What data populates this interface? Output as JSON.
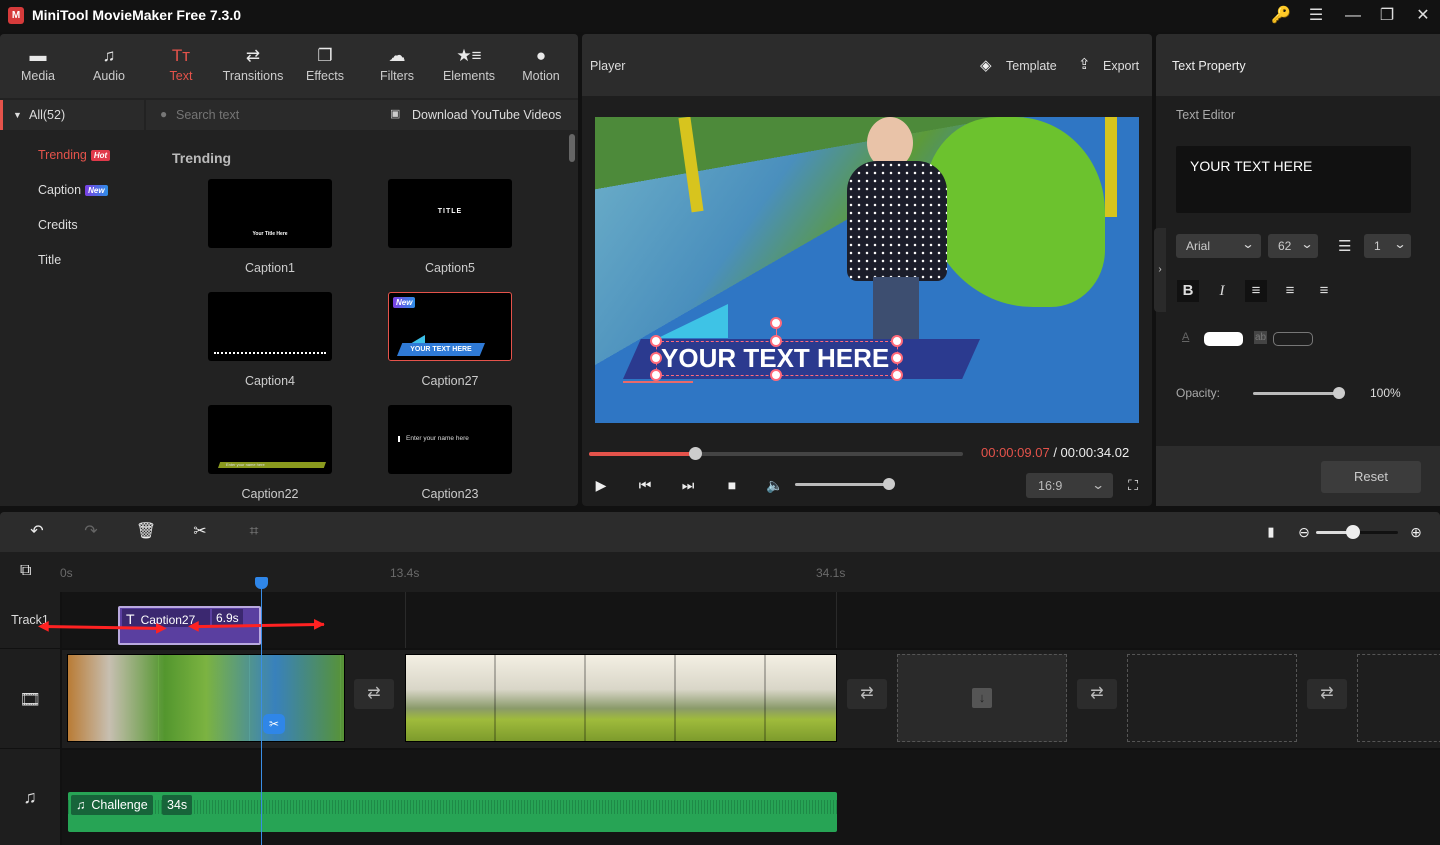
{
  "app": {
    "title": "MiniTool MovieMaker Free 7.3.0",
    "logo_glyph": "M"
  },
  "window_controls": [
    {
      "name": "key-icon",
      "glyph": "🔑"
    },
    {
      "name": "menu-icon",
      "glyph": "☰"
    },
    {
      "name": "minimize-icon",
      "glyph": "—"
    },
    {
      "name": "restore-icon",
      "glyph": "❐"
    },
    {
      "name": "close-icon",
      "glyph": "✕"
    }
  ],
  "toolbar": {
    "tabs": [
      {
        "id": "media",
        "label": "Media",
        "icon": "folder-icon",
        "glyph": "▬"
      },
      {
        "id": "audio",
        "label": "Audio",
        "icon": "music-note-icon",
        "glyph": "♫"
      },
      {
        "id": "text",
        "label": "Text",
        "icon": "text-icon",
        "glyph": "Tт",
        "active": true
      },
      {
        "id": "transitions",
        "label": "Transitions",
        "icon": "swap-arrows-icon",
        "glyph": "⇄"
      },
      {
        "id": "effects",
        "label": "Effects",
        "icon": "layers-square-icon",
        "glyph": "❐"
      },
      {
        "id": "filters",
        "label": "Filters",
        "icon": "circles-icon",
        "glyph": "☁"
      },
      {
        "id": "elements",
        "label": "Elements",
        "icon": "star-list-icon",
        "glyph": "★≡"
      },
      {
        "id": "motion",
        "label": "Motion",
        "icon": "motion-circle-icon",
        "glyph": "●"
      }
    ]
  },
  "library": {
    "category_header": "All(52)",
    "search_placeholder": "Search text",
    "download_label": "Download YouTube Videos",
    "categories": [
      {
        "label": "Trending",
        "badge": "Hot",
        "badge_color": "#e0394a",
        "active": true
      },
      {
        "label": "Caption",
        "badge": "New",
        "badge_color": "#5b5ce6"
      },
      {
        "label": "Credits"
      },
      {
        "label": "Title"
      }
    ],
    "section_title": "Trending",
    "items": [
      {
        "name": "Caption1",
        "preview_text": "Your Title Here"
      },
      {
        "name": "Caption5",
        "preview_text": "TITLE"
      },
      {
        "name": "Caption4",
        "preview_text": ""
      },
      {
        "name": "Caption27",
        "preview_text": "YOUR TEXT HERE",
        "badge": "New",
        "selected": true
      },
      {
        "name": "Caption22",
        "preview_text": "Enter your name here"
      },
      {
        "name": "Caption23",
        "preview_text": "Enter your name here"
      }
    ]
  },
  "player": {
    "title": "Player",
    "template_label": "Template",
    "export_label": "Export",
    "overlay_text": "YOUR TEXT HERE",
    "current_time": "00:00:09.07",
    "total_time": "/ 00:00:34.02",
    "progress": 0.284,
    "volume": 1.0,
    "aspect_ratio": "16:9"
  },
  "text_property": {
    "title": "Text Property",
    "editor_label": "Text Editor",
    "text_value": "YOUR TEXT HERE",
    "font": "Arial",
    "font_size": "62",
    "line_spacing": "1",
    "bold": true,
    "align": "left",
    "text_color": "#ffffff",
    "opacity_label": "Opacity:",
    "opacity_value": "100%",
    "opacity": 1.0,
    "reset_label": "Reset"
  },
  "timeline": {
    "ruler": [
      "0s",
      "13.4s",
      "34.1s"
    ],
    "zoom_level": 0.45,
    "tracks": {
      "text_track_label": "Track1"
    },
    "caption_clip": {
      "name": "Caption27",
      "duration": "6.9s"
    },
    "audio_clip": {
      "name": "Challenge",
      "duration": "34s"
    }
  }
}
